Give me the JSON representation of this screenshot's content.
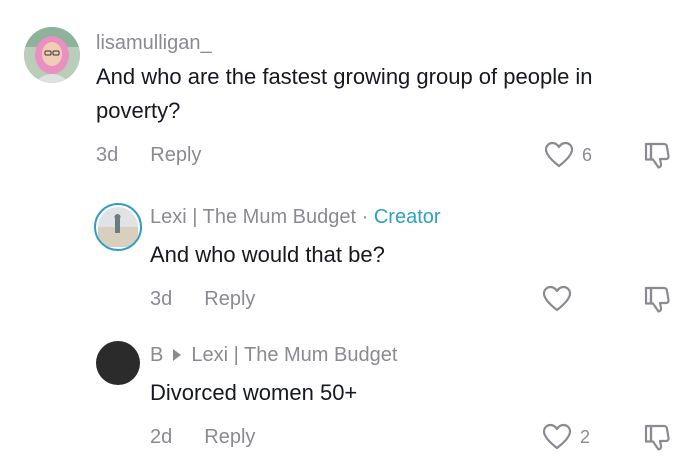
{
  "comments": [
    {
      "username": "lisamulligan_",
      "text": "And who are the fastest growing group of people in poverty?",
      "time": "3d",
      "reply_label": "Reply",
      "likes": "6",
      "avatar_icon": "profile-photo-pink-hair"
    },
    {
      "username": "Lexi | The Mum Budget",
      "separator": "·",
      "badge": "Creator",
      "text": "And who would that be?",
      "time": "3d",
      "reply_label": "Reply",
      "likes": "",
      "avatar_icon": "profile-photo-beach"
    },
    {
      "username": "B",
      "reply_to": "Lexi | The Mum Budget",
      "text": "Divorced women 50+",
      "time": "2d",
      "reply_label": "Reply",
      "likes": "2",
      "avatar_icon": "dark-circle-avatar"
    }
  ],
  "colors": {
    "creator": "#2f9fc4",
    "muted": "#8a8b91",
    "text": "#161823"
  }
}
